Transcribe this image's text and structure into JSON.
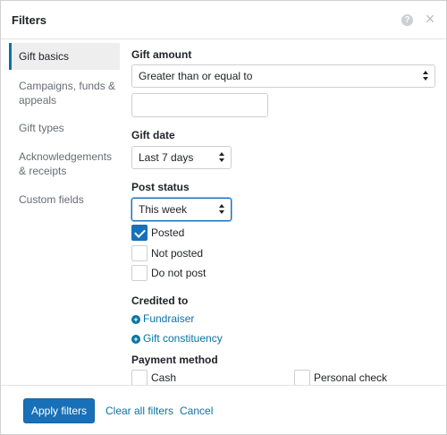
{
  "dialog": {
    "title": "Filters",
    "help_icon": "?",
    "close_icon": "×"
  },
  "sidebar": {
    "items": [
      {
        "label": "Gift basics",
        "active": true
      },
      {
        "label": "Campaigns, funds & appeals",
        "active": false
      },
      {
        "label": "Gift types",
        "active": false
      },
      {
        "label": "Acknowledgements & receipts",
        "active": false
      },
      {
        "label": "Custom fields",
        "active": false
      }
    ]
  },
  "gift_amount": {
    "label": "Gift amount",
    "operator": "Greater than or equal to",
    "value": ""
  },
  "gift_date": {
    "label": "Gift date",
    "value": "Last 7 days"
  },
  "post_status": {
    "label": "Post status",
    "date_value": "This week",
    "options": [
      {
        "label": "Posted",
        "checked": true
      },
      {
        "label": "Not posted",
        "checked": false
      },
      {
        "label": "Do not post",
        "checked": false
      }
    ]
  },
  "credited_to": {
    "label": "Credited to",
    "links": [
      {
        "label": "Fundraiser",
        "icon": "plus-circle-icon"
      },
      {
        "label": "Gift constituency",
        "icon": "plus-circle-icon"
      }
    ]
  },
  "payment_method": {
    "label": "Payment method",
    "options": [
      {
        "label": "Cash",
        "checked": false
      },
      {
        "label": "Personal check",
        "checked": false
      }
    ]
  },
  "footer": {
    "apply_label": "Apply filters",
    "clear_label": "Clear all filters",
    "cancel_label": "Cancel"
  },
  "colors": {
    "accent": "#1870b8",
    "link": "#0974a1",
    "active_nav_bg": "#eeeeef"
  }
}
